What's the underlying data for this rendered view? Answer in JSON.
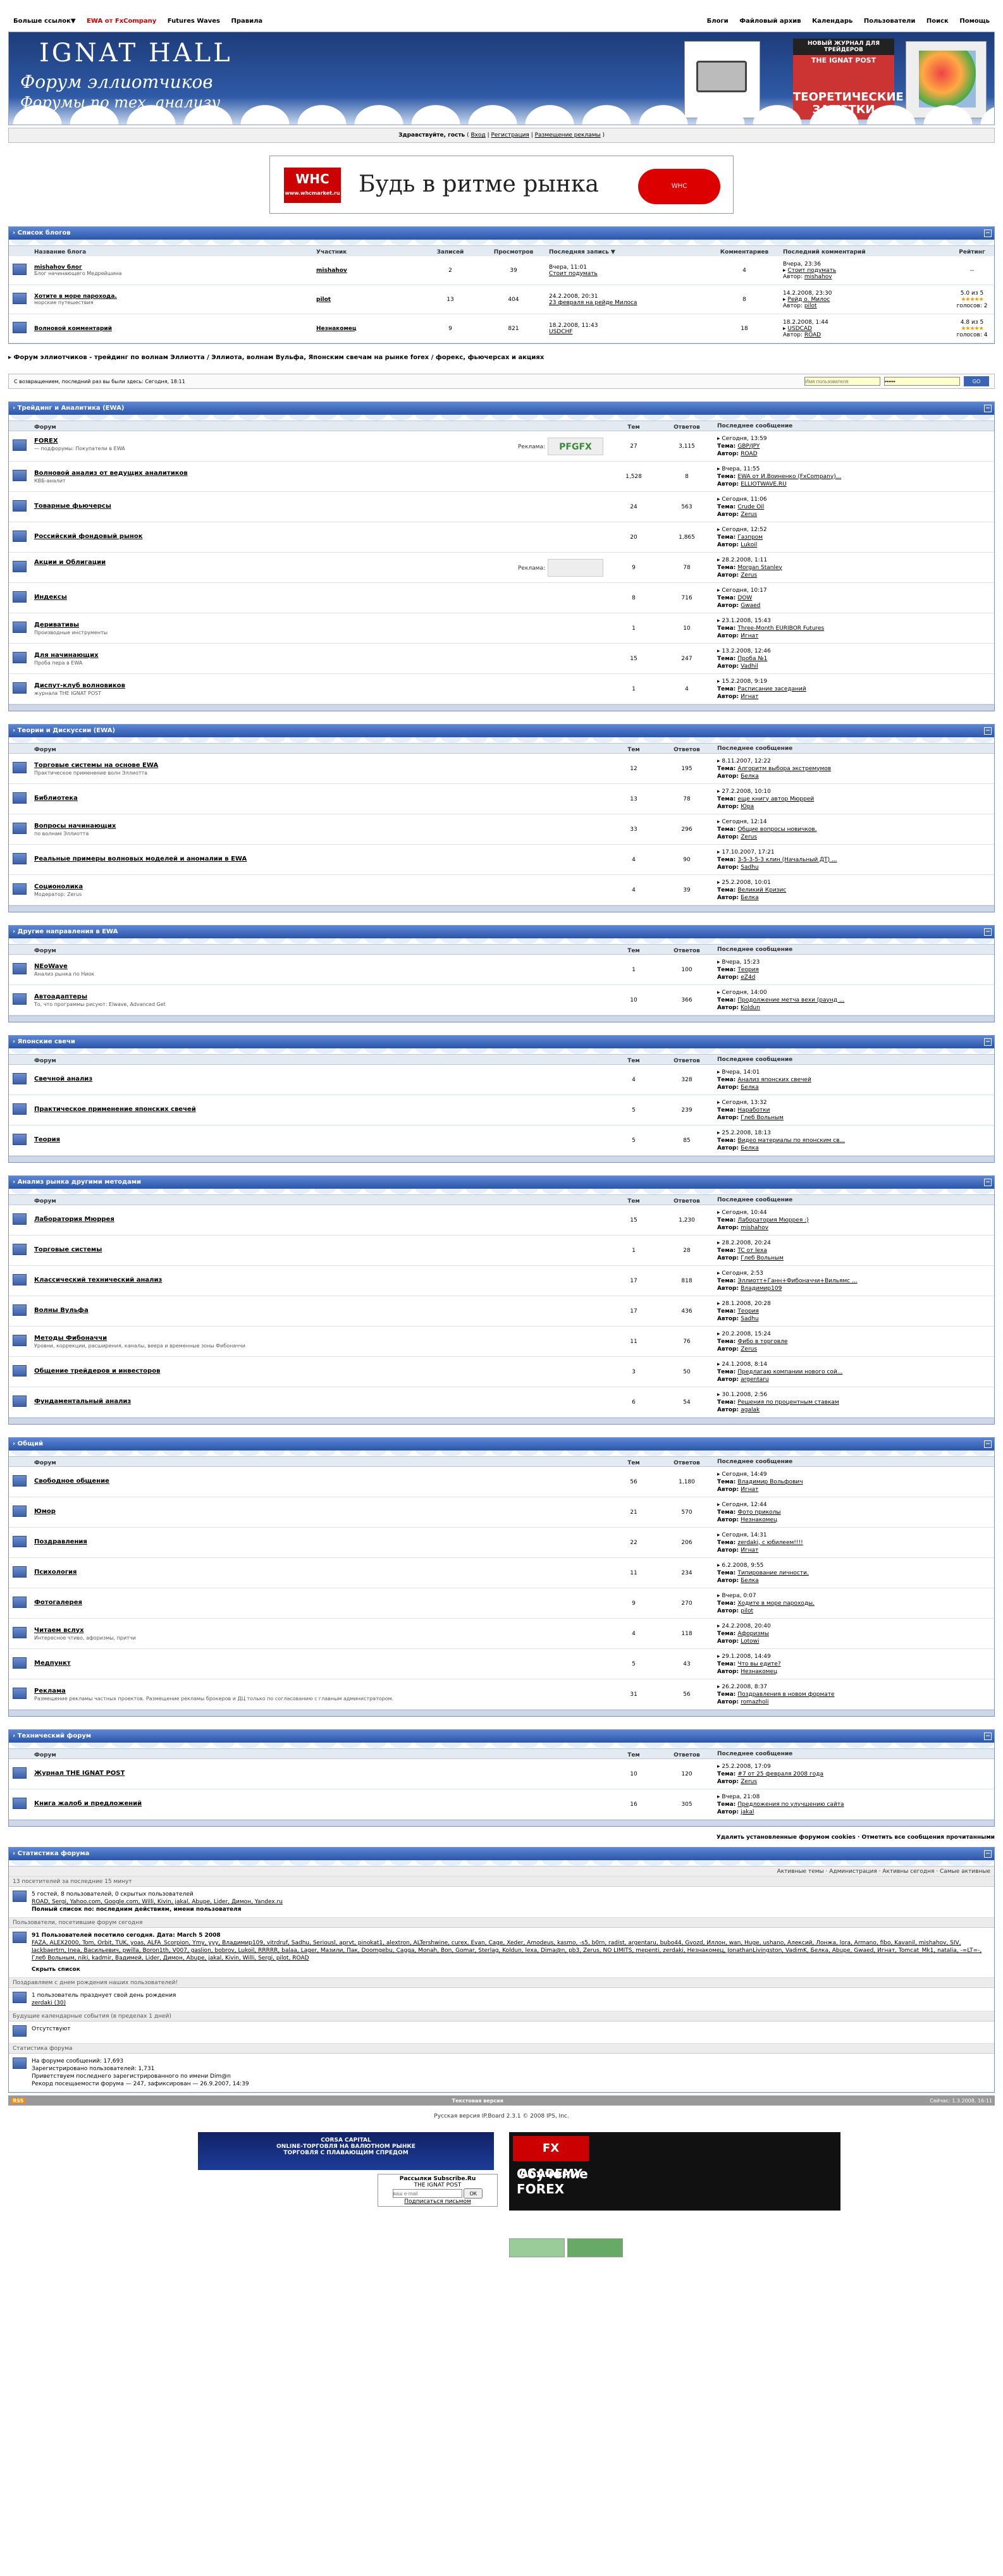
{
  "topnav": {
    "left": [
      "Больше ссылок▼",
      "EWA от FxCompany",
      "Futures Waves",
      "Правила"
    ],
    "right": [
      "Блоги",
      "Файловый архив",
      "Календарь",
      "Пользователи",
      "Поиск",
      "Помощь"
    ]
  },
  "header": {
    "logo_line1": "IGNAT HALL",
    "logo_line2": "Форум эллиотчиков",
    "logo_line3": "Форумы по тех. анализу",
    "banner_b_top": "НОВЫЙ ЖУРНАЛ ДЛЯ ТРЕЙДЕРОВ",
    "banner_b_brand": "THE IGNAT POST",
    "banner_b_main": "ТЕОРЕТИЧЕСКИЕ ЗАМЕТКИ"
  },
  "welcome": {
    "text": "Здравствуйте, гость",
    "links": [
      "Вход",
      "Регистрация",
      "Размещение рекламы"
    ]
  },
  "promo": {
    "brand": "WHC",
    "brand_sub": "www.whcmarket.ru",
    "slogan": "Будь в ритме рынка",
    "mouse": "WHC"
  },
  "blogs": {
    "title": "Список блогов",
    "columns": [
      "Название блога",
      "Участник",
      "Записей",
      "Просмотров",
      "Последняя запись ▼",
      "Комментариев",
      "Последний комментарий",
      "Рейтинг"
    ],
    "rows": [
      {
        "name": "mishahov блог",
        "desc": "Блог начинающего Медрейшина",
        "author": "mishahov",
        "posts": "2",
        "views": "39",
        "last": "Вчера, 11:01",
        "last_title": "Стоит подумать",
        "comments": "4",
        "lc_date": "Вчера, 23:36",
        "lc_topic": "Стоит подумать",
        "lc_author": "mishahov",
        "rating": "--",
        "votes": ""
      },
      {
        "name": "Хотите в море парохода.",
        "desc": "морские путешествия",
        "author": "pilot",
        "posts": "13",
        "views": "404",
        "last": "24.2.2008, 20:31",
        "last_title": "23 февраля на рейде Милоса",
        "comments": "8",
        "lc_date": "14.2.2008, 23:30",
        "lc_topic": "Рейд о. Милос",
        "lc_author": "pilot",
        "rating": "5.0 из 5",
        "votes": "голосов: 2"
      },
      {
        "name": "Волновой комментарий",
        "desc": "",
        "author": "Незнакомец",
        "posts": "9",
        "views": "821",
        "last": "18.2.2008, 11:43",
        "last_title": "USDCHF",
        "comments": "18",
        "lc_date": "18.2.2008, 1:44",
        "lc_topic": "USDCAD",
        "lc_author": "ROAD",
        "rating": "4.8 из 5",
        "votes": "голосов: 4"
      }
    ]
  },
  "path": "Форум эллиотчиков - трейдинг по волнам Эллиотта / Эллиота, волнам Вульфа, Японским свечам на рынке forex / форекс, фьючерсах и акциях",
  "login": {
    "msg": "С возвращением, последний раз вы были здесь: Сегодня, 18:11",
    "user_ph": "Имя пользователя",
    "pass_val": "••••••",
    "go": "GO"
  },
  "col_labels": {
    "forum": "Форум",
    "topics": "Тем",
    "replies": "Ответов",
    "last": "Последнее сообщение"
  },
  "categories": [
    {
      "title": "Трейдинг и Аналитика (EWA)",
      "forums": [
        {
          "name": "FOREX",
          "desc": "— подфорумы: Покупатели в EWA",
          "ad": "Реклама:",
          "ad_txt": "PFGFX",
          "topics": "27",
          "replies": "3,115",
          "date": "Сегодня, 13:59",
          "theme": "GBP/JPY",
          "author": "ROAD"
        },
        {
          "name": "Волновой анализ от ведущих аналитиков",
          "desc": "КВБ-аналит",
          "topics": "1,528",
          "replies": "8",
          "date": "Вчера, 11:55",
          "theme": "EWA от И.Воиненко (FxCompany)...",
          "author": "ELLIOTWAVE.RU"
        },
        {
          "name": "Товарные фьючерсы",
          "desc": "",
          "topics": "24",
          "replies": "563",
          "date": "Сегодня, 11:06",
          "theme": "Crude Oil",
          "author": "Zerus"
        },
        {
          "name": "Российский фондовый рынок",
          "desc": "",
          "topics": "20",
          "replies": "1,865",
          "date": "Сегодня, 12:52",
          "theme": "Газпром",
          "author": "Lukoil"
        },
        {
          "name": "Акции и Облигации",
          "desc": "",
          "ad": "Реклама:",
          "ad_txt": "",
          "topics": "9",
          "replies": "78",
          "date": "28.2.2008, 1:11",
          "theme": "Morgan Stanley",
          "author": "Zerus"
        },
        {
          "name": "Индексы",
          "desc": "",
          "topics": "8",
          "replies": "716",
          "date": "Сегодня, 10:17",
          "theme": "DOW",
          "author": "Gwaed"
        },
        {
          "name": "Деривативы",
          "desc": "Производные инструменты",
          "topics": "1",
          "replies": "10",
          "date": "23.1.2008, 15:43",
          "theme": "Three-Month EURIBOR Futures",
          "author": "Игнат"
        },
        {
          "name": "Для начинающих",
          "desc": "Проба пера в EWA",
          "topics": "15",
          "replies": "247",
          "date": "13.2.2008, 12:46",
          "theme": "Проба №1",
          "author": "Vadhil"
        },
        {
          "name": "Диспут-клуб волновиков",
          "desc": "журнала THE IGNAT POST",
          "topics": "1",
          "replies": "4",
          "date": "15.2.2008, 9:19",
          "theme": "Расписание заседаний",
          "author": "Игнат"
        }
      ]
    },
    {
      "title": "Теории и Дискуссии (EWA)",
      "forums": [
        {
          "name": "Торговые системы на основе EWA",
          "desc": "Практическое применение волн Эллиотта",
          "topics": "12",
          "replies": "195",
          "date": "8.11.2007, 12:22",
          "theme": "Алгоритм выбора экстремумов",
          "author": "Белка"
        },
        {
          "name": "Библиотека",
          "desc": "",
          "topics": "13",
          "replies": "78",
          "date": "27.2.2008, 10:10",
          "theme": "еще книгу автор Мюррей",
          "author": "Юрa"
        },
        {
          "name": "Вопросы начинающих",
          "desc": "по волнам Эллиотта",
          "topics": "33",
          "replies": "296",
          "date": "Сегодня, 12:14",
          "theme": "Общие вопросы новичков.",
          "author": "Zerus"
        },
        {
          "name": "Реальные примеры волновых моделей и аномалии в EWA",
          "desc": "",
          "topics": "4",
          "replies": "90",
          "date": "17.10.2007, 17:21",
          "theme": "3-5-3-5-3 клин (Начальный ДТ) ...",
          "author": "Sadhu"
        },
        {
          "name": "Соционолика",
          "desc": "Модератор: Zerus",
          "topics": "4",
          "replies": "39",
          "date": "25.2.2008, 10:01",
          "theme": "Великий Кризис",
          "author": "Белка"
        }
      ]
    },
    {
      "title": "Другие направления в EWA",
      "forums": [
        {
          "name": "NEoWave",
          "desc": "Анализ рынка по Ниок",
          "topics": "1",
          "replies": "100",
          "date": "Вчера, 15:23",
          "theme": "Теория",
          "author": "eZ4d"
        },
        {
          "name": "Автоадаптеры",
          "desc": "То, что программы рисуют: Elwave, Advanced Get",
          "topics": "10",
          "replies": "366",
          "date": "Сегодня, 14:00",
          "theme": "Продолжение метча вехи (раунд ...",
          "author": "Koldun"
        }
      ]
    },
    {
      "title": "Японские свечи",
      "forums": [
        {
          "name": "Свечной анализ",
          "desc": "",
          "topics": "4",
          "replies": "328",
          "date": "Вчера, 14:01",
          "theme": "Анализ японских свечей",
          "author": "Белка"
        },
        {
          "name": "Практическое применение японских свечей",
          "desc": "",
          "topics": "5",
          "replies": "239",
          "date": "Сегодня, 13:32",
          "theme": "Наработки",
          "author": "Глеб Вольным"
        },
        {
          "name": "Теория",
          "desc": "",
          "topics": "5",
          "replies": "85",
          "date": "25.2.2008, 18:13",
          "theme": "Видео материалы по японским св...",
          "author": "Белка"
        }
      ]
    },
    {
      "title": "Анализ рынка другими методами",
      "forums": [
        {
          "name": "Лаборатория Мюррея",
          "desc": "",
          "topics": "15",
          "replies": "1,230",
          "date": "Сегодня, 10:44",
          "theme": "Лаборатория Мюррея :)",
          "author": "mishahov"
        },
        {
          "name": "Торговые системы",
          "desc": "",
          "topics": "1",
          "replies": "28",
          "date": "28.2.2008, 20:24",
          "theme": "TC от lexa",
          "author": "Глеб Вольным"
        },
        {
          "name": "Классический технический анализ",
          "desc": "",
          "topics": "17",
          "replies": "818",
          "date": "Сегодня, 2:53",
          "theme": "Эллиотт+Ганн+Фибоначчи+Вильямс ...",
          "author": "Владимир109"
        },
        {
          "name": "Волны Вульфа",
          "desc": "",
          "topics": "17",
          "replies": "436",
          "date": "28.1.2008, 20:28",
          "theme": "Теория",
          "author": "Sadhu"
        },
        {
          "name": "Методы Фибоначчи",
          "desc": "Уровни, коррекции, расширения, каналы, веера и временные зоны Фибоначчи",
          "topics": "11",
          "replies": "76",
          "date": "20.2.2008, 15:24",
          "theme": "Фибо в торговле",
          "author": "Zerus"
        },
        {
          "name": "Общение трейдеров и инвесторов",
          "desc": "",
          "topics": "3",
          "replies": "50",
          "date": "24.1.2008, 8:14",
          "theme": "Предлагаю компании нового сой...",
          "author": "argentaru"
        },
        {
          "name": "Фундаментальный анализ",
          "desc": "",
          "topics": "6",
          "replies": "54",
          "date": "30.1.2008, 2:56",
          "theme": "Решения по процентным ставкам",
          "author": "agalak"
        }
      ]
    },
    {
      "title": "Общий",
      "forums": [
        {
          "name": "Свободное общение",
          "desc": "",
          "topics": "56",
          "replies": "1,180",
          "date": "Сегодня, 14:49",
          "theme": "Владимир Вольфович",
          "author": "Игнат"
        },
        {
          "name": "Юмор",
          "desc": "",
          "topics": "21",
          "replies": "570",
          "date": "Сегодня, 12:44",
          "theme": "Фото приколы",
          "author": "Незнакомец"
        },
        {
          "name": "Поздравления",
          "desc": "",
          "topics": "22",
          "replies": "206",
          "date": "Сегодня, 14:31",
          "theme": "zerdaki, с юбилеем!!!!",
          "author": "Игнат"
        },
        {
          "name": "Психология",
          "desc": "",
          "topics": "11",
          "replies": "234",
          "date": "6.2.2008, 9:55",
          "theme": "Типирование личности.",
          "author": "Белка"
        },
        {
          "name": "Фотогалерея",
          "desc": "",
          "topics": "9",
          "replies": "270",
          "date": "Вчера, 0:07",
          "theme": "Ходите в море пароходы.",
          "author": "pilot"
        },
        {
          "name": "Читаем вслух",
          "desc": "Интересное чтиво, афоризмы, притчи",
          "topics": "4",
          "replies": "118",
          "date": "24.2.2008, 20:40",
          "theme": "Афоризмы",
          "author": "Lotowi"
        },
        {
          "name": "Медпункт",
          "desc": "",
          "topics": "5",
          "replies": "43",
          "date": "29.1.2008, 14:49",
          "theme": "Что вы едите?",
          "author": "Незнакомец"
        },
        {
          "name": "Реклама",
          "desc": "Размещение рекламы частных проектов. Размещение рекламы брокеров и ДЦ только по согласованию с главным администратором.",
          "topics": "31",
          "replies": "56",
          "date": "26.2.2008, 8:37",
          "theme": "Поздравления в новом формате",
          "author": "romazholi"
        }
      ]
    },
    {
      "title": "Технический форум",
      "forums": [
        {
          "name": "Журнал THE IGNAT POST",
          "desc": "",
          "topics": "10",
          "replies": "120",
          "date": "25.2.2008, 17:09",
          "theme": "#7 от 25 февраля 2008 года",
          "author": "Zerus"
        },
        {
          "name": "Книга жалоб и предложений",
          "desc": "",
          "topics": "16",
          "replies": "305",
          "date": "Вчера, 21:08",
          "theme": "Предложения по улучшению сайта",
          "author": "jakal"
        }
      ]
    }
  ],
  "cookies_line": "Удалить установленные форумом cookies · Отметить все сообщения прочитанными",
  "stats": {
    "title": "Статистика форума",
    "tabs": "Активные темы · Администрация · Активны сегодня · Самые активные",
    "online_head": "13 посетителей за последние 15 минут",
    "online_line": "5 гостей, 8 пользователей, 0 скрытых пользователей",
    "online_users": "ROAD, Sergi, Yahoo.com, Google.com, Willi, Kivin, jakal, Abupe, Lider, Димон, Yandex.ru",
    "online_full": "Полный список по: последним действиям, имени пользователя",
    "today_head": "Пользователи, посетившие форум сегодня",
    "today_line": "91 Пользователей посетило сегодня. Дата: March 5 2008",
    "today_users": "FAZA, ALEX2000, Tom, Orbit, TUK, yoas, ALFA_Scorpion, Ymy, yyy, Владимир109, vitrdruf, Sadhu, Seriousl, aprvt, pinokat1, alextron, ALTershwine, curex, Evan, Cage, Xeder, Amodeus, kasmo, -s5, b0rn, radist, argentaru, bubo44, Gvozd, Иллон, wan, Huge, ushano, Алексий, Лонжа, lora, Armano, fibo, Kavanil, mishahov, SIV, Jackbaertrn, Inea, Васильевич, pwilla, Boron1th, V007, gaslion, bobrov, Lukoil, RRRRR, balaa, Lager, Мазили, Пак, Doomgebu, Cagga, Monah, Bon, Gomar, Sterlag, Koldun, lexa, Dima@n, pb3, Zerus, NO LIMITS, mepenti, zerdaki, Незнакомец, JonathanLivingston, VadimK, Белка, Abupe, Gwaed, Игнат, Tomcat_Mk1, natalia, -=LT=-, Глеб Вольным, niki, kadmir, Вадимей, Lider, Димон, Abupe, jakal, Kivin, Willi, Sergi, pilot, ROAD",
    "hide_list": "Скрыть список",
    "bday_head": "Поздравляем с днем рождения наших пользователей!",
    "bday_line": "1 пользователь празднует свой день рождения",
    "bday_user": "zerdaki (30)",
    "events_head": "Будущие календарные события (в пределах 1 дней)",
    "events_line": "Отсутствуют",
    "forum_head": "Статистика форума",
    "forum_l1": "На форуме сообщений: 17,693",
    "forum_l2": "Зарегистрировано пользователей: 1,731",
    "forum_l3": "Приветствуем последнего зарегистрированного по имени Dim@n",
    "forum_l4": "Рекорд посещаемости форума — 247, зафиксирован — 26.9.2007, 14:39"
  },
  "rss": {
    "label": "RSS",
    "mid": "Текстовая версия",
    "right": "Сейчас: 1.3.2008, 16:11"
  },
  "copyright": "Русская версия IP.Board 2.3.1 © 2008 IPS, Inc.",
  "footer": {
    "banner_a_l1": "CORSA CAPITAL",
    "banner_a_l2": "ONLINE-ТОРГОВЛЯ НА ВАЛЮТНОМ РЫНКЕ",
    "banner_a_l3": "ТОРГОВЛЯ С ПЛАВАЮЩИМ СПРЕДОМ",
    "fx_brand": "FX ACADEMY",
    "fx_l1": "Обучение",
    "fx_l2": "FOREX",
    "subscribe_l1": "Рассылки Subscribe.Ru",
    "subscribe_l2": "THE IGNAT POST",
    "subscribe_ph": "ваш e-mail",
    "subscribe_btn": "OK",
    "subscribe_l3": "Подписаться письмом"
  }
}
